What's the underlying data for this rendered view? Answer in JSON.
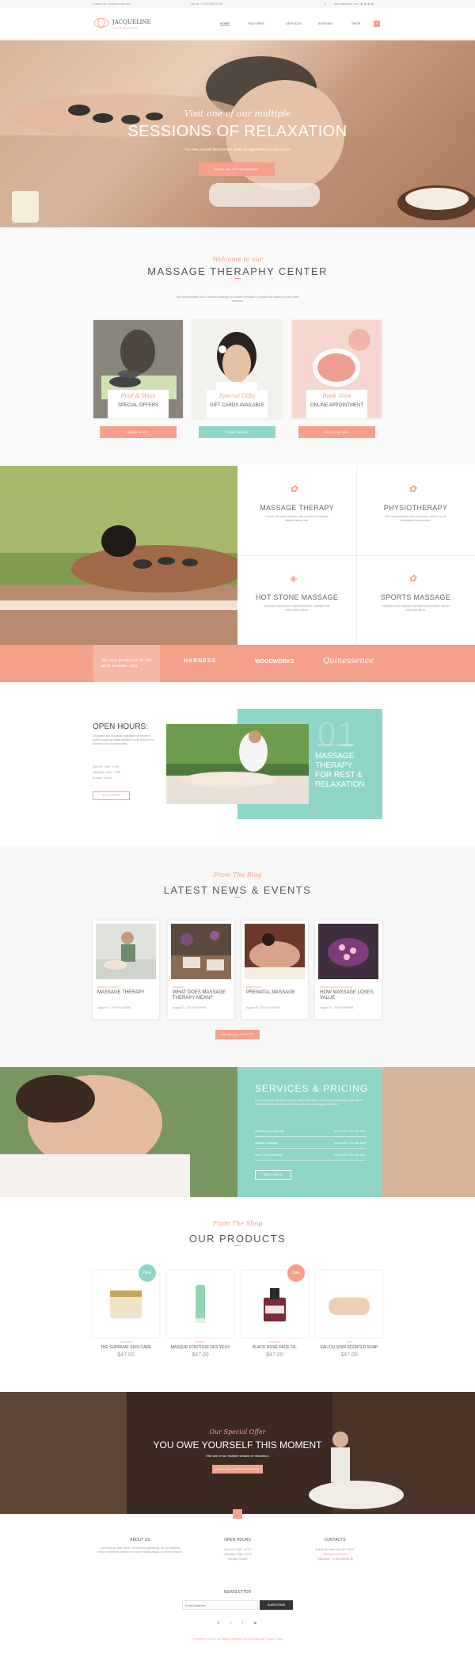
{
  "topbar": {
    "email": "Contact Us: info@yoursite.com",
    "phone": "Call Us: +1 800 555 55 55",
    "login": "Buy Jacqueline now"
  },
  "brand": {
    "name": "JACQUELINE",
    "tagline": "Massage therapy center"
  },
  "nav": [
    "HOME",
    "FEATURES",
    "SERVICES",
    "BOOKING",
    "SHOP"
  ],
  "hero": {
    "script": "Visit one of our multiple",
    "title": "SESSIONS OF RELAXATION",
    "subtitle": "You owe yourself this moment. Make an appointment in just a click!",
    "button": "Make an appointment"
  },
  "welcome": {
    "script": "Welcome to our",
    "title": "MASSAGE THERAPHY CENTER",
    "text": "You deserve better than a rushed massage by a rookie therapist in a place that makes you feel more stressed",
    "cards": [
      {
        "script": "Find & Wish",
        "title": "SPECIAL OFFERS",
        "button": "Read more",
        "color": "#f4a08a"
      },
      {
        "script": "Special Gifts",
        "title": "GIFT CARDS AVAILABLE",
        "button": "Read more",
        "color": "#8fd6c8"
      },
      {
        "script": "Book Now",
        "title": "ONLINE APPOINTMENT",
        "button": "Read more",
        "color": "#f4a08a"
      }
    ]
  },
  "services": [
    {
      "title": "MASSAGE THERAPY",
      "text": "Ut enim ad minim veniam, quis nostrud exercitation ullamco laboris nisi."
    },
    {
      "title": "PHYSIOTHERAPY",
      "text": "Sed ut perspiciatis unde omnis iste natus error sit voluptatem accusantium."
    },
    {
      "title": "HOT STONE MASSAGE",
      "text": "Duis aute irure dolor in reprehenderit in voluptate velit esse cillum dolore."
    },
    {
      "title": "SPORTS MASSAGE",
      "text": "Excepteur sint occaecat cupidatat non proident, sunt in culpa qui officia."
    }
  ],
  "brands": {
    "text": "We use products of the best brands only",
    "logos": [
      "HARNESS",
      "WOODWORKS",
      "Quinessence"
    ]
  },
  "hours": {
    "title": "OPEN HOURS:",
    "text": "Excepteur sint occaecat cupidatat non proident, sunt in culpa qui officia deserunt mollit anim id est laborum. Sed ut perspiciatis.",
    "lines": [
      "Mon-Fri: 9 AM - 6 PM",
      "Saturday: 9 AM - 4 PM",
      "Sunday: Closed"
    ],
    "button": "Read more",
    "number": "01",
    "meta": "July 2, 2017 / 0 Comments",
    "feature": "MASSAGE THERAPY FOR REST & RELAXATION"
  },
  "news": {
    "script": "From The Blog",
    "title": "LATEST NEWS & EVENTS",
    "posts": [
      {
        "cat": "Massage Therapy",
        "title": "MASSAGE THERAPY",
        "meta": "August 21, 2017 by ADMIN"
      },
      {
        "cat": "General",
        "title": "WHAT DOES MASSAGE THERAPY MEAN?",
        "meta": "August 21, 2017 by ADMIN"
      },
      {
        "cat": "Stretching",
        "title": "PRENATAL MASSAGE",
        "meta": "August 21, 2017 by ADMIN"
      },
      {
        "cat": "Physiotherapy, Physical",
        "title": "HOW MASSAGE LOSES VALUE",
        "meta": "August 21, 2017 by ADMIN"
      }
    ],
    "button": "View all posts"
  },
  "pricing": {
    "title": "SERVICES & PRICING",
    "text": "At our massage therapists center, every massage is customized according to the client's individual needs as well as the therapist's own training and intuition.",
    "rows": [
      {
        "name": "Aromatherapy Massage",
        "price": "60 min $70 / 90 min $100"
      },
      {
        "name": "Swedish Massage",
        "price": "60 min $70 / 90 min $100"
      },
      {
        "name": "Deep Tissue Massage",
        "price": "60 min $70 / 90 min $100"
      }
    ],
    "button": "Book online"
  },
  "products": {
    "script": "From The Shop",
    "title": "OUR PRODUCTS",
    "items": [
      {
        "cat": "Skincare",
        "name": "THE SUPREME SKIN CARE",
        "price": "$47.00",
        "badge": "New"
      },
      {
        "cat": "Makeup",
        "name": "MASQUE CONTOUR DES YEUX",
        "price": "$47.00",
        "badge": ""
      },
      {
        "cat": "Skincare",
        "name": "BLACK ROSE FACE OIL",
        "price": "$47.00",
        "badge": "Sale"
      },
      {
        "cat": "Soap",
        "name": "EAU DU SOIN SCENTED SOAP",
        "price": "$47.00",
        "badge": ""
      }
    ]
  },
  "offer": {
    "script": "Our Special Offer",
    "title": "YOU OWE YOURSELF THIS MOMENT",
    "subtitle": "Visit one of our multiple session of relaxation.",
    "button": "Make an appointment"
  },
  "footer": {
    "about_title": "ABOUT US",
    "about_text": "Lorem ipsum dolor amet, consectetur adipiscing, sed do eiusmod tempor incididunt ut labore et dolore magna aliqua. Ut enim ad minim.",
    "hours_title": "OPEN HOURS",
    "hours_lines": [
      "Mon-Fri: 9 AM - 6 PM",
      "Saturday: 9 AM - 4 PM",
      "Sunday: Closed"
    ],
    "contacts_title": "CONTACTS",
    "contacts_lines": [
      "8 Main St, New York, NY 10001",
      "info@yoursite.com",
      "Telephone: +1 800 555 55 55"
    ],
    "newsletter_title": "NEWSLETTER",
    "newsletter_placeholder": "Email Address",
    "subscribe": "SUBSCRIBE",
    "copyright": "ThemeREX © 2017 All Rights Reserved. Terms of Use and Privacy Policy"
  },
  "colors": {
    "coral": "#f4a08a",
    "teal": "#8fd6c8"
  }
}
